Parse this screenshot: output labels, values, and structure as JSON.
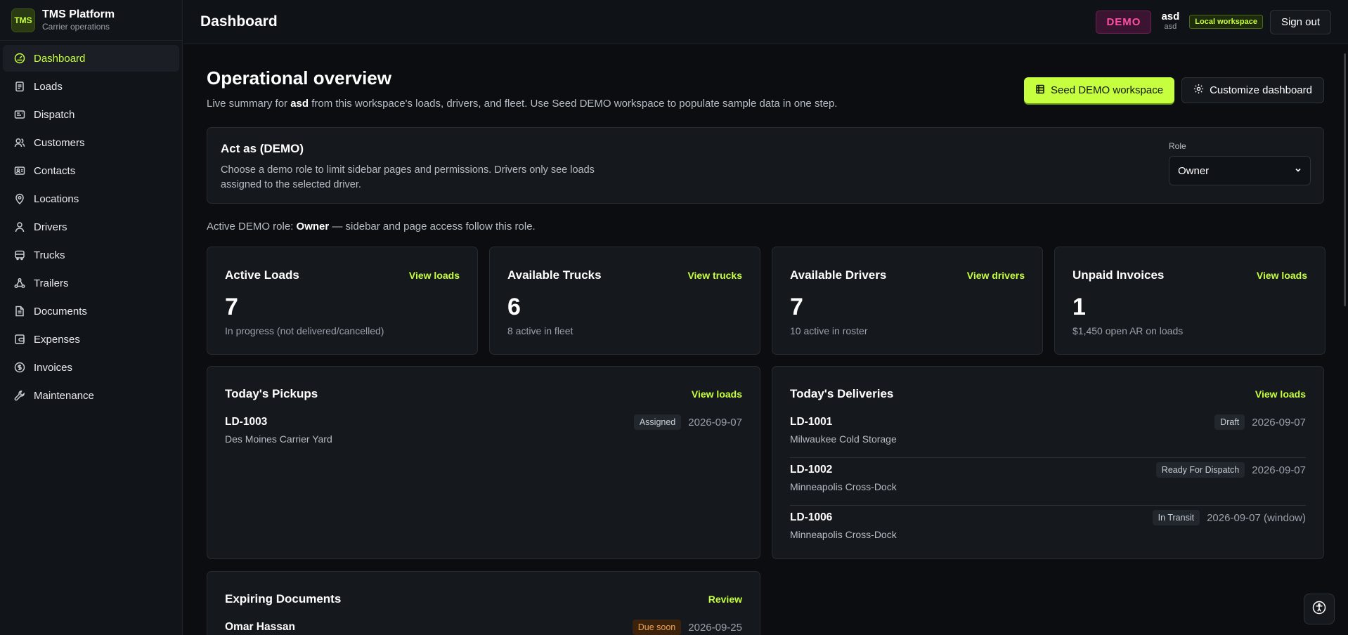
{
  "brand": {
    "logo": "TMS",
    "title": "TMS Platform",
    "subtitle": "Carrier operations"
  },
  "sidebar": {
    "items": [
      {
        "label": "Dashboard",
        "icon": "gauge-icon",
        "active": true
      },
      {
        "label": "Loads",
        "icon": "clipboard-icon"
      },
      {
        "label": "Dispatch",
        "icon": "dispatch-icon"
      },
      {
        "label": "Customers",
        "icon": "users-icon"
      },
      {
        "label": "Contacts",
        "icon": "contact-card-icon"
      },
      {
        "label": "Locations",
        "icon": "map-pin-icon"
      },
      {
        "label": "Drivers",
        "icon": "user-icon"
      },
      {
        "label": "Trucks",
        "icon": "bus-icon"
      },
      {
        "label": "Trailers",
        "icon": "share-icon"
      },
      {
        "label": "Documents",
        "icon": "file-icon"
      },
      {
        "label": "Expenses",
        "icon": "wallet-icon"
      },
      {
        "label": "Invoices",
        "icon": "dollar-circle-icon"
      },
      {
        "label": "Maintenance",
        "icon": "wrench-icon"
      }
    ]
  },
  "header": {
    "title": "Dashboard",
    "demo_badge": "DEMO",
    "user_name": "asd",
    "user_sub": "asd",
    "workspace_badge": "Local workspace",
    "signout_label": "Sign out"
  },
  "overview": {
    "title": "Operational overview",
    "subtitle_prefix": "Live summary for ",
    "subtitle_user": "asd",
    "subtitle_suffix": " from this workspace's loads, drivers, and fleet. Use Seed DEMO workspace to populate sample data in one step.",
    "seed_label": "Seed DEMO workspace",
    "customize_label": "Customize dashboard"
  },
  "act_as": {
    "title": "Act as (DEMO)",
    "description": "Choose a demo role to limit sidebar pages and permissions. Drivers only see loads assigned to the selected driver.",
    "role_label": "Role",
    "role_value": "Owner"
  },
  "active_role": {
    "prefix": "Active DEMO role: ",
    "role": "Owner",
    "suffix": " — sidebar and page access follow this role."
  },
  "stats": [
    {
      "title": "Active Loads",
      "link": "View loads",
      "value": "7",
      "sub": "In progress (not delivered/cancelled)"
    },
    {
      "title": "Available Trucks",
      "link": "View trucks",
      "value": "6",
      "sub": "8 active in fleet"
    },
    {
      "title": "Available Drivers",
      "link": "View drivers",
      "value": "7",
      "sub": "10 active in roster"
    },
    {
      "title": "Unpaid Invoices",
      "link": "View loads",
      "value": "1",
      "sub": "$1,450 open AR on loads"
    }
  ],
  "pickups": {
    "title": "Today's Pickups",
    "link": "View loads",
    "rows": [
      {
        "id": "LD-1003",
        "location": "Des Moines Carrier Yard",
        "status": "Assigned",
        "date": "2026-09-07"
      }
    ]
  },
  "deliveries": {
    "title": "Today's Deliveries",
    "link": "View loads",
    "rows": [
      {
        "id": "LD-1001",
        "location": "Milwaukee Cold Storage",
        "status": "Draft",
        "date": "2026-09-07"
      },
      {
        "id": "LD-1002",
        "location": "Minneapolis Cross-Dock",
        "status": "Ready For Dispatch",
        "date": "2026-09-07"
      },
      {
        "id": "LD-1006",
        "location": "Minneapolis Cross-Dock",
        "status": "In Transit",
        "date": "2026-09-07 (window)"
      }
    ]
  },
  "expiring": {
    "title": "Expiring Documents",
    "link": "Review",
    "rows": [
      {
        "name": "Omar Hassan",
        "status": "Due soon",
        "date": "2026-09-25"
      }
    ]
  },
  "colors": {
    "accent": "#c6ff3d",
    "demo": "#ff4fa3",
    "background": "#0b0d10",
    "card": "#15181d"
  }
}
